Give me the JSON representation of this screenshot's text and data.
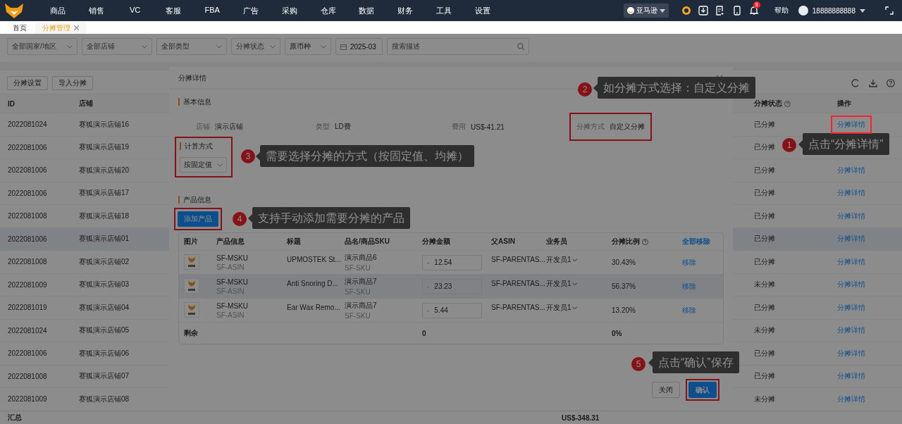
{
  "nav": {
    "menu": [
      "商品",
      "销售",
      "VC",
      "客服",
      "FBA",
      "广告",
      "采购",
      "仓库",
      "数据",
      "财务",
      "工具",
      "设置"
    ],
    "platform": "亚马逊",
    "notification_count": "8",
    "help": "帮助",
    "account": "18888888888"
  },
  "tabs": [
    {
      "label": "首页",
      "selected": false,
      "closable": false
    },
    {
      "label": "分摊管理",
      "selected": true,
      "closable": true
    }
  ],
  "filters": [
    {
      "kind": "select",
      "placeholder": "全部国家/地区"
    },
    {
      "kind": "select",
      "placeholder": "全部店铺"
    },
    {
      "kind": "select",
      "placeholder": "全部类型"
    },
    {
      "kind": "select",
      "placeholder": "分摊状态"
    },
    {
      "kind": "select",
      "value": "原币种"
    },
    {
      "kind": "date",
      "value": "2025-03"
    },
    {
      "kind": "search",
      "placeholder": "搜索描述"
    }
  ],
  "toolbar": [
    "分摊设置",
    "导入分摊"
  ],
  "table": {
    "columns": [
      "ID",
      "店铺",
      "分摊状态",
      "操作"
    ],
    "rows": [
      {
        "id": "2022081024",
        "store": "赛狐演示店铺16",
        "status": "已分摊",
        "action": "分摊详情",
        "selected": false,
        "highlighted": true
      },
      {
        "id": "2022081006",
        "store": "赛狐演示店铺19",
        "status": "已分摊",
        "selected": false
      },
      {
        "id": "2022081006",
        "store": "赛狐演示店铺20",
        "status": "已分摊",
        "action": "分摊详情",
        "selected": false,
        "highlighted": false
      },
      {
        "id": "2022081006",
        "store": "赛狐演示店铺17",
        "status": "已分摊",
        "action": "分摊详情",
        "selected": false,
        "highlighted": false
      },
      {
        "id": "2022081008",
        "store": "赛狐演示店铺18",
        "status": "已分摊",
        "action": "分摊详情",
        "selected": false,
        "highlighted": false
      },
      {
        "id": "2022081006",
        "store": "赛狐演示店铺01",
        "status": "已分摊",
        "action": "分摊详情",
        "selected": true,
        "highlighted": false
      },
      {
        "id": "2022081008",
        "store": "赛狐演示店铺02",
        "status": "已分摊",
        "action": "分摊详情",
        "selected": false,
        "highlighted": false
      },
      {
        "id": "2022081009",
        "store": "赛狐演示店铺03",
        "status": "未分摊",
        "action": "分摊详情",
        "selected": false,
        "highlighted": false
      },
      {
        "id": "2022081019",
        "store": "赛狐演示店铺04",
        "status": "已分摊",
        "action": "分摊详情",
        "selected": false,
        "highlighted": false
      },
      {
        "id": "2022081024",
        "store": "赛狐演示店铺05",
        "status": "未分摊",
        "action": "分摊详情",
        "selected": false,
        "highlighted": false
      },
      {
        "id": "2022081006",
        "store": "赛狐演示店铺06",
        "status": "已分摊",
        "action": "分摊详情",
        "selected": false,
        "highlighted": false
      },
      {
        "id": "2022081008",
        "store": "赛狐演示店铺07",
        "status": "已分摊",
        "action": "分摊详情",
        "selected": false,
        "highlighted": false
      },
      {
        "id": "2022081009",
        "store": "赛狐演示店铺08",
        "status": "未分摊",
        "action": "分摊详情",
        "selected": false,
        "highlighted": false
      }
    ],
    "total": {
      "label": "汇总",
      "amount": "US$-348.31"
    }
  },
  "modal": {
    "title": "分摊详情",
    "basic": {
      "title": "基本信息",
      "fields": [
        {
          "label": "店铺",
          "value": "演示店铺",
          "highlighted": false
        },
        {
          "label": "类型",
          "value": "LD费",
          "highlighted": false
        },
        {
          "label": "费用",
          "value": "US$-41.21",
          "highlighted": false
        },
        {
          "label": "分摊方式",
          "value": "自定义分摊",
          "highlighted": true
        }
      ]
    },
    "calc": {
      "title": "计算方式",
      "value": "按固定值",
      "highlighted": true
    },
    "products": {
      "title": "产品信息",
      "add_button": {
        "label": "添加产品",
        "highlighted": true
      },
      "columns": [
        "图片",
        "产品信息",
        "标题",
        "品名/商品SKU",
        "分摊金额",
        "父ASIN",
        "业务员",
        "分摊比例"
      ],
      "remove_all": "全部移除",
      "rows": [
        {
          "msku": "SF-MSKU",
          "asin": "SF-ASIN",
          "title": "UPMOSTEK St...",
          "name": "演示商品6",
          "sku": "SF-SKU",
          "prefix": "-",
          "amount": "12.54",
          "parent": "SF-PARENTAS...",
          "staff": "开发员1",
          "ratio": "30.43%",
          "action": "移除",
          "selected": false
        },
        {
          "msku": "SF-MSKU",
          "asin": "SF-ASIN",
          "title": "Anti Snoring D...",
          "name": "演示商品7",
          "sku": "SF-SKU",
          "prefix": "-",
          "amount": "23.23",
          "parent": "SF-PARENTAS...",
          "staff": "开发员1",
          "ratio": "56.37%",
          "action": "移除",
          "selected": true
        },
        {
          "msku": "SF-MSKU",
          "asin": "SF-ASIN",
          "title": "Ear Wax Remo...",
          "name": "演示商品7",
          "sku": "SF-SKU",
          "prefix": "-",
          "amount": "5.44",
          "parent": "SF-PARENTAS...",
          "staff": "开发员1",
          "ratio": "13.20%",
          "action": "移除",
          "selected": false
        }
      ],
      "remainder": {
        "label": "剩余",
        "amount": "0",
        "ratio": "0%"
      }
    },
    "buttons": [
      {
        "label": "关闭",
        "kind": "default",
        "highlighted": false
      },
      {
        "label": "确认",
        "kind": "primary",
        "highlighted": true
      }
    ]
  },
  "callouts": [
    {
      "number": "1",
      "text": "点击“分摊详情”"
    },
    {
      "number": "2",
      "text": "如分摊方式选择：自定义分摊"
    },
    {
      "number": "3",
      "text": "需要选择分摊的方式（按固定值、均摊）"
    },
    {
      "number": "4",
      "text": "支持手动添加需要分摊的产品"
    },
    {
      "number": "5",
      "text": "点击“确认”保存"
    }
  ]
}
